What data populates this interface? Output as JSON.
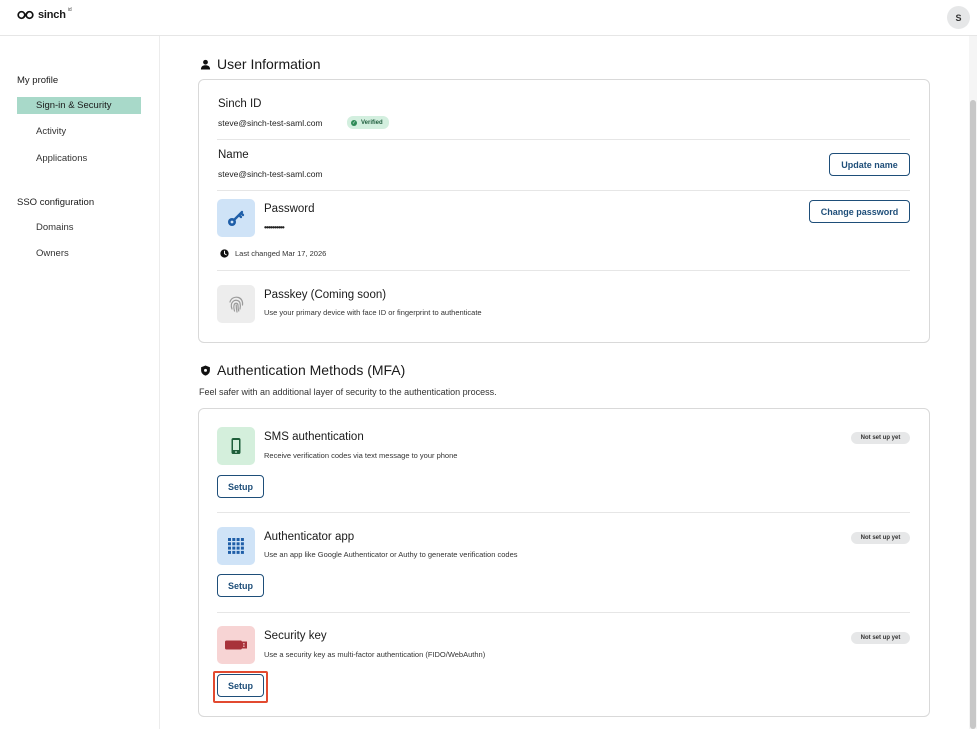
{
  "header": {
    "brand_name": "sinch",
    "brand_sup": "id",
    "avatar_initial": "S"
  },
  "sidebar": {
    "groups": [
      {
        "heading": "My profile",
        "items": [
          {
            "label": "Sign-in & Security",
            "active": true
          },
          {
            "label": "Activity"
          },
          {
            "label": "Applications"
          }
        ]
      },
      {
        "heading": "SSO configuration",
        "items": [
          {
            "label": "Domains"
          },
          {
            "label": "Owners"
          }
        ]
      }
    ]
  },
  "user_info": {
    "title": "User Information",
    "sinch_id": {
      "label": "Sinch ID",
      "value": "steve@sinch-test-saml.com",
      "badge": "Verified"
    },
    "name": {
      "label": "Name",
      "value": "steve@sinch-test-saml.com",
      "button": "Update name"
    },
    "password": {
      "label": "Password",
      "value": "••••••••••",
      "button": "Change password",
      "last_changed": "Last changed Mar 17, 2026"
    },
    "passkey": {
      "label": "Passkey (Coming soon)",
      "description": "Use your primary device with face ID or fingerprint to authenticate"
    }
  },
  "mfa": {
    "title": "Authentication Methods (MFA)",
    "description": "Feel safer with an additional layer of security to the authentication process.",
    "methods": [
      {
        "name": "SMS authentication",
        "description": "Receive verification codes via text message to your phone",
        "status": "Not set up yet",
        "button": "Setup",
        "icon": "phone-icon"
      },
      {
        "name": "Authenticator app",
        "description": "Use an app like Google Authenticator or Authy to generate verification codes",
        "status": "Not set up yet",
        "button": "Setup",
        "icon": "keypad-icon"
      },
      {
        "name": "Security key",
        "description": "Use a security key as multi-factor authentication (FIDO/WebAuthn)",
        "status": "Not set up yet",
        "button": "Setup",
        "icon": "usb-key-icon"
      }
    ]
  },
  "colors": {
    "accent": "#1e4e79",
    "sidebar_active": "#a8d9c9",
    "verified_bg": "#d3efdf",
    "highlight": "#e24a30"
  }
}
